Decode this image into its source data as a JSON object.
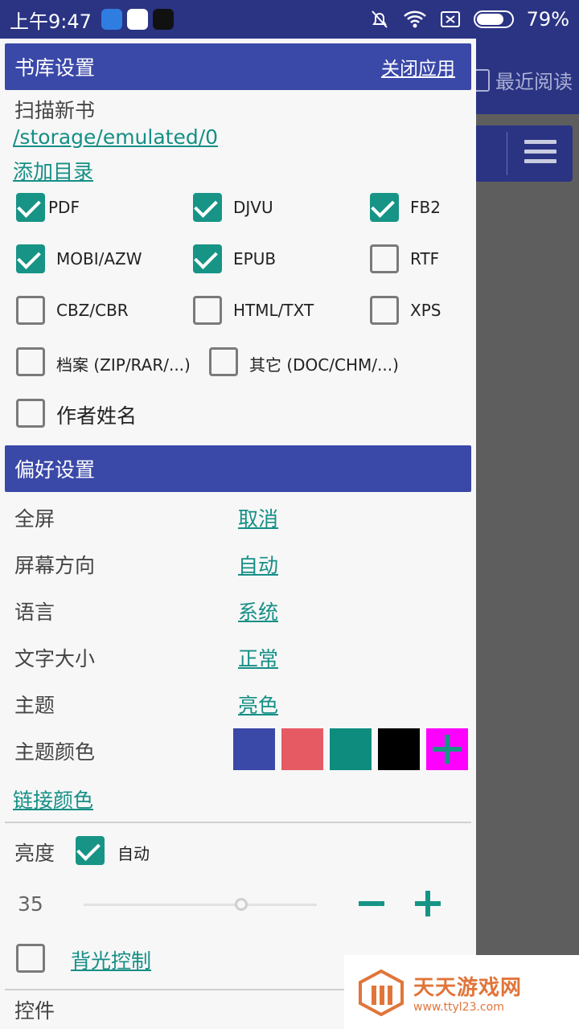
{
  "status_bar": {
    "time": "上午9:47",
    "battery": "79%",
    "battery_level": 0.79
  },
  "background": {
    "recent_label": "最近阅读"
  },
  "library": {
    "header_title": "书库设置",
    "close_app": "关闭应用",
    "scan_label": "扫描新书",
    "path": "/storage/emulated/0",
    "add_dir": "添加目录",
    "formats": [
      {
        "label": "PDF",
        "checked": true
      },
      {
        "label": "DJVU",
        "checked": true
      },
      {
        "label": "FB2",
        "checked": true
      },
      {
        "label": "MOBI/AZW",
        "checked": true
      },
      {
        "label": "EPUB",
        "checked": true
      },
      {
        "label": "RTF",
        "checked": false
      },
      {
        "label": "CBZ/CBR",
        "checked": false
      },
      {
        "label": "HTML/TXT",
        "checked": false
      },
      {
        "label": "XPS",
        "checked": false
      },
      {
        "label": "档案 (ZIP/RAR/...)",
        "checked": false
      },
      {
        "label": "其它 (DOC/CHM/...)",
        "checked": false
      }
    ],
    "author_name": {
      "label": "作者姓名",
      "checked": false
    }
  },
  "prefs": {
    "header_title": "偏好设置",
    "rows": [
      {
        "label": "全屏",
        "value": "取消"
      },
      {
        "label": "屏幕方向",
        "value": "自动"
      },
      {
        "label": "语言",
        "value": "系统"
      },
      {
        "label": "文字大小",
        "value": "正常"
      },
      {
        "label": "主题",
        "value": "亮色"
      }
    ],
    "theme_color_label": "主题颜色",
    "theme_colors": [
      "#3a48a8",
      "#e65a63",
      "#0e8c7e",
      "#000000",
      "#ff00ff"
    ],
    "link_color": "链接颜色",
    "brightness_label": "亮度",
    "auto_label": "自动",
    "auto_checked": true,
    "brightness_value": "35",
    "backlight_label": "背光控制",
    "backlight_checked": false,
    "controls_label": "控件"
  },
  "watermark": {
    "brand": "天天游戏网",
    "url": "www.ttyl23.com"
  },
  "colors": {
    "primary": "#3a48a8",
    "accent": "#179485",
    "statusbar": "#2b3483"
  }
}
